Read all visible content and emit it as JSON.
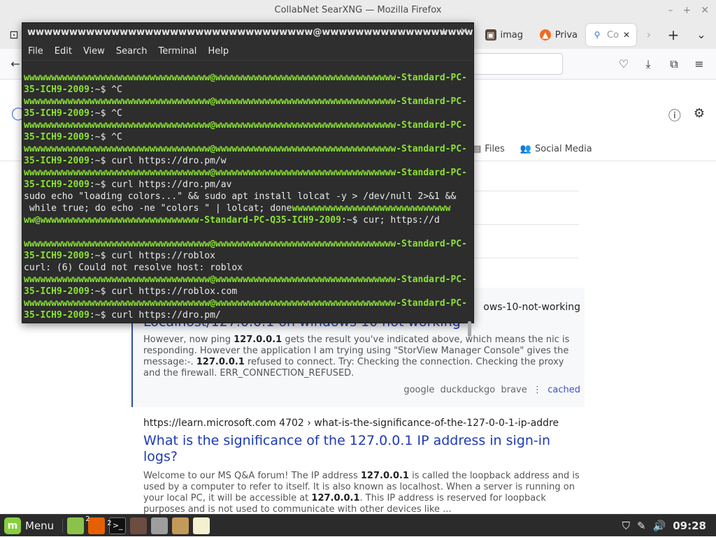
{
  "firefox": {
    "window_title": "CollabNet SearXNG — Mozilla Firefox",
    "tabs": [
      {
        "label": "imag",
        "icon": "image-tab-icon"
      },
      {
        "label": "Priva",
        "icon": "brave-icon"
      },
      {
        "label": "Co",
        "icon": "search-icon"
      }
    ]
  },
  "page": {
    "categories": [
      {
        "label": "Files"
      },
      {
        "label": "Social Media"
      }
    ],
    "result1": {
      "url_partial": "ows-10-not-working",
      "title": "Localhost/127.0.0.1 on windows 10 not working",
      "snippet_parts": [
        "However, now ping ",
        "127.0.0.1",
        " gets the result you've indicated above, which means the nic is responding. However the application I am trying using \"StorView Manager Console\" gives the message:-. ",
        "127.0.0.1",
        " refused to connect. Try: Checking the connection. Checking the proxy and the firewall. ERR_CONNECTION_REFUSED."
      ],
      "engines": [
        "google",
        "duckduckgo",
        "brave"
      ],
      "cached_label": "cached"
    },
    "result2": {
      "url": "https://learn.microsoft.com  4702 › what-is-the-significance-of-the-127-0-0-1-ip-addre",
      "title": "What is the significance of the 127.0.0.1 IP address in sign-in logs?",
      "snippet_parts": [
        "Welcome to our MS Q&A forum! The IP address ",
        "127.0.0.1",
        " is called the loopback address and is used by a computer to refer to itself. It is also known as localhost. When a server is running on your local PC, it will be accessible at ",
        "127.0.0.1",
        ". This IP address is reserved for loopback purposes and is not used to communicate with other devices like ..."
      ]
    }
  },
  "terminal": {
    "title": "wwwwwwwwwwwwwwwwwwwwwwwwwwwwwwwwww@wwwwwwwwwwwwwwwwwwwwwww...",
    "menu": [
      "File",
      "Edit",
      "View",
      "Search",
      "Terminal",
      "Help"
    ],
    "lines": [
      [
        {
          "t": "wwwwwwwwwwwwwwwwwwwwwwwwwwwwwwwwww@wwwwwwwwwwwwwwwwwwwwwwwwwwwwwwwww-Standard-PC-Q",
          "g": true
        }
      ],
      [
        {
          "t": "35-ICH9-2009",
          "g": true
        },
        {
          "t": ":~$ ^C",
          "g": false
        }
      ],
      [
        {
          "t": "wwwwwwwwwwwwwwwwwwwwwwwwwwwwwwwwww@wwwwwwwwwwwwwwwwwwwwwwwwwwwwwwwww-Standard-PC-Q",
          "g": true
        }
      ],
      [
        {
          "t": "35-ICH9-2009",
          "g": true
        },
        {
          "t": ":~$ ^C",
          "g": false
        }
      ],
      [
        {
          "t": "wwwwwwwwwwwwwwwwwwwwwwwwwwwwwwwwww@wwwwwwwwwwwwwwwwwwwwwwwwwwwwwwwww-Standard-PC-Q",
          "g": true
        }
      ],
      [
        {
          "t": "35-ICH9-2009",
          "g": true
        },
        {
          "t": ":~$ ^C",
          "g": false
        }
      ],
      [
        {
          "t": "wwwwwwwwwwwwwwwwwwwwwwwwwwwwwwwwww@wwwwwwwwwwwwwwwwwwwwwwwwwwwwwwwww-Standard-PC-Q",
          "g": true
        }
      ],
      [
        {
          "t": "35-ICH9-2009",
          "g": true
        },
        {
          "t": ":~$ curl https://dro.pm/w",
          "g": false
        }
      ],
      [
        {
          "t": "wwwwwwwwwwwwwwwwwwwwwwwwwwwwwwwwww@wwwwwwwwwwwwwwwwwwwwwwwwwwwwwwwww-Standard-PC-Q",
          "g": true
        }
      ],
      [
        {
          "t": "35-ICH9-2009",
          "g": true
        },
        {
          "t": ":~$ curl https://dro.pm/av",
          "g": false
        }
      ],
      [
        {
          "t": "sudo echo \"loading colors...\" && sudo apt install lolcat -y > /dev/null 2>&1 &&",
          "g": false
        }
      ],
      [
        {
          "t": " while true; do echo -ne \"colors \" | lolcat; done",
          "g": false
        },
        {
          "t": "wwwwwwwwwwwwwwwwwwwwwwwwwwwww",
          "g": true
        }
      ],
      [
        {
          "t": "ww@wwwwwwwwwwwwwwwwwwwwwwwwwwwww-Standard-PC-Q35-ICH9-2009",
          "g": true
        },
        {
          "t": ":~$ cur; https://d",
          "g": false
        }
      ],
      [
        {
          "t": "",
          "g": false
        }
      ],
      [
        {
          "t": "wwwwwwwwwwwwwwwwwwwwwwwwwwwwwwwwww@wwwwwwwwwwwwwwwwwwwwwwwwwwwwwwwww-Standard-PC-Q",
          "g": true
        }
      ],
      [
        {
          "t": "35-ICH9-2009",
          "g": true
        },
        {
          "t": ":~$ curl https://roblox",
          "g": false
        }
      ],
      [
        {
          "t": "curl: (6) Could not resolve host: roblox",
          "g": false
        }
      ],
      [
        {
          "t": "wwwwwwwwwwwwwwwwwwwwwwwwwwwwwwwwww@wwwwwwwwwwwwwwwwwwwwwwwwwwwwwwwww-Standard-PC-Q",
          "g": true
        }
      ],
      [
        {
          "t": "35-ICH9-2009",
          "g": true
        },
        {
          "t": ":~$ curl https://roblox.com",
          "g": false
        }
      ],
      [
        {
          "t": "wwwwwwwwwwwwwwwwwwwwwwwwwwwwwwwwww@wwwwwwwwwwwwwwwwwwwwwwwwwwwwwwwww-Standard-PC-Q",
          "g": true
        }
      ],
      [
        {
          "t": "35-ICH9-2009",
          "g": true
        },
        {
          "t": ":~$ curl https://dro.pm/",
          "g": false
        }
      ]
    ]
  },
  "panel": {
    "menu_label": "Menu",
    "firefox_badge": "2",
    "terminal_badge": "2",
    "clock": "09:28"
  }
}
